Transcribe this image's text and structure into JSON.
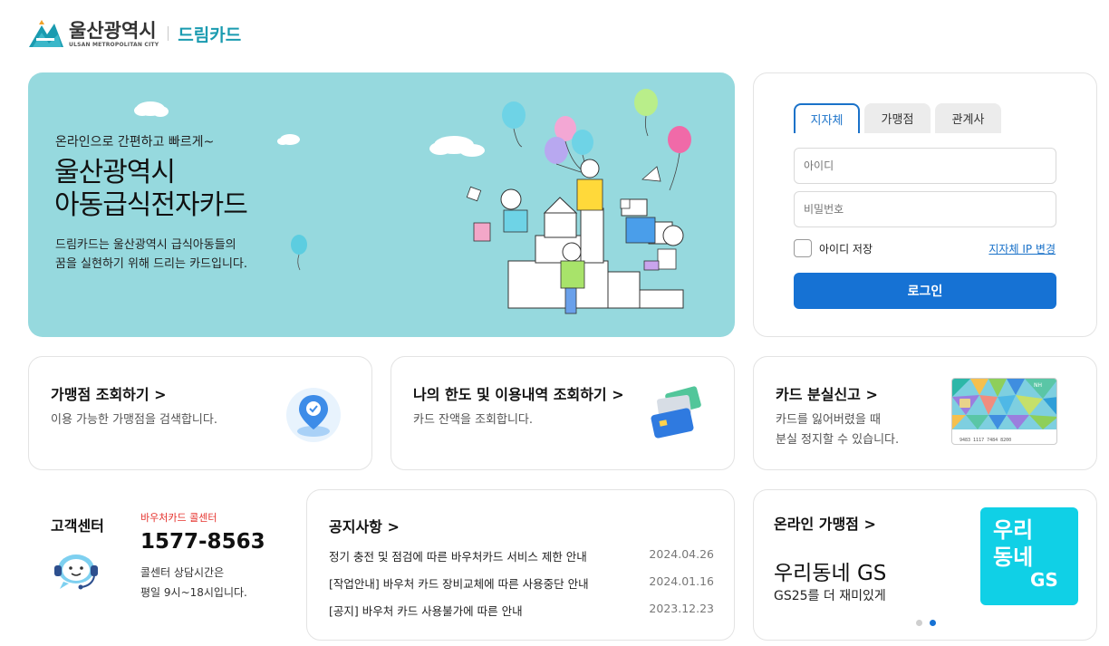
{
  "header": {
    "city_name": "울산광역시",
    "city_name_en": "ULSAN METROPOLITAN CITY",
    "service_name": "드림카드"
  },
  "hero": {
    "subtitle": "온라인으로 간편하고 빠르게~",
    "title_line1": "울산광역시",
    "title_line2": "아동급식전자카드",
    "desc_line1": "드림카드는 울산광역시 급식아동들의",
    "desc_line2": "꿈을 실현하기 위해 드리는 카드입니다.",
    "background_color": "#96d9de"
  },
  "login": {
    "tabs": [
      {
        "label": "지자체",
        "active": true
      },
      {
        "label": "가맹점",
        "active": false
      },
      {
        "label": "관계사",
        "active": false
      }
    ],
    "id_placeholder": "아이디",
    "pw_placeholder": "비밀번호",
    "save_id_label": "아이디 저장",
    "save_id_checked": false,
    "ip_change_link": "지자체 IP 변경",
    "login_button": "로그인",
    "accent_color": "#1672d4"
  },
  "cards": [
    {
      "title": "가맹점 조회하기 >",
      "desc": "이용 가능한 가맹점을 검색합니다.",
      "icon": "map-pin-icon"
    },
    {
      "title": "나의 한도 및 이용내역 조회하기 >",
      "desc": "카드 잔액을 조회합니다.",
      "icon": "card-money-icon"
    },
    {
      "title": "카드 분실신고 >",
      "desc_line1": "카드를 잃어버렸을 때",
      "desc_line2": "분실 정지할 수 있습니다.",
      "icon": "dream-card-image",
      "card_number": "9483 1117 7484 8200"
    }
  ],
  "customer_center": {
    "title": "고객센터",
    "label": "바우처카드 콜센터",
    "phone": "1577-8563",
    "hours_line1": "콜센터 상담시간은",
    "hours_line2": "평일 9시~18시입니다.",
    "label_color": "#e5322d"
  },
  "notice": {
    "title": "공지사항 >",
    "items": [
      {
        "text": "정기 충전 및 점검에 따른 바우처카드 서비스 제한 안내",
        "date": "2024.04.26"
      },
      {
        "text": "[작업안내] 바우처 카드 장비교체에 따른 사용중단 안내",
        "date": "2024.01.16"
      },
      {
        "text": "[공지] 바우처 카드 사용불가에 따른 안내",
        "date": "2023.12.23"
      }
    ]
  },
  "online_store": {
    "title": "온라인 가맹점 >",
    "name": "우리동네 GS",
    "desc": "GS25를 더 재미있게",
    "logo_line1": "우리",
    "logo_line2": "동네",
    "logo_line3": "GS",
    "logo_color": "#10d0e6",
    "slides_total": 2,
    "active_slide": 2
  }
}
